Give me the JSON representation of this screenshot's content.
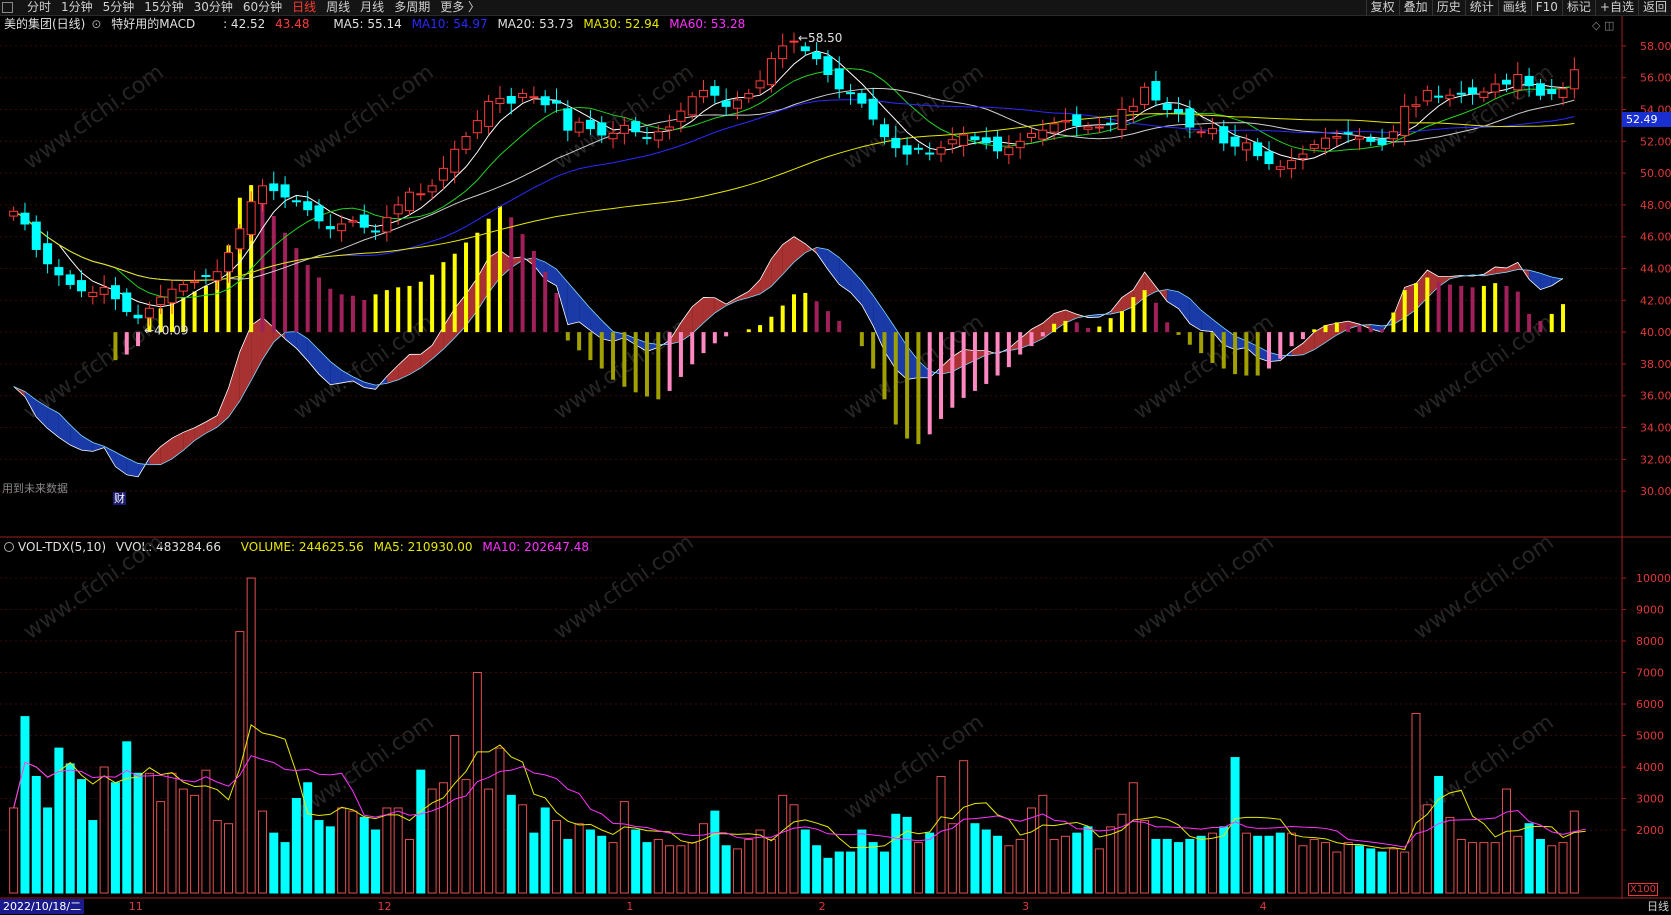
{
  "toolbar": {
    "periods": [
      "分时",
      "1分钟",
      "5分钟",
      "15分钟",
      "30分钟",
      "60分钟",
      "日线",
      "周线",
      "月线",
      "多周期",
      "更多 〉"
    ],
    "active_period": "日线",
    "right_buttons": [
      "复权",
      "叠加",
      "历史",
      "统计",
      "画线",
      "F10",
      "标记",
      "+自选",
      "返回"
    ]
  },
  "main_info": {
    "stock": "美的集团(日线)",
    "indicator": "特好用的MACD",
    "val1": ": 42.52",
    "val2": "43.48",
    "ma5": "MA5: 55.14",
    "ma10": "MA10: 54.97",
    "ma20": "MA20: 53.73",
    "ma30": "MA30: 52.94",
    "ma60": "MA60: 53.28"
  },
  "vol_info": {
    "name": "VOL-TDX(5,10)",
    "vvol": "VVOL: 483284.66",
    "volume": "VOLUME: 244625.56",
    "ma5": "MA5: 210930.00",
    "ma10": "MA10: 202647.48"
  },
  "price_axis": [
    "58.00",
    "56.00",
    "54.00",
    "52.00",
    "50.00",
    "48.00",
    "46.00",
    "44.00",
    "42.00",
    "40.00",
    "38.00",
    "36.00",
    "34.00",
    "32.00",
    "30.00"
  ],
  "vol_axis": [
    "10000",
    "9000",
    "8000",
    "7000",
    "6000",
    "5000",
    "4000",
    "3000",
    "2000"
  ],
  "high_label": "58.50",
  "low_label": "40.09",
  "current_price": "52.49",
  "future_note": "用到未来数据",
  "fin_badge": "财",
  "date_box": "2022/10/18/二",
  "month_labels": [
    "11",
    "12",
    "1",
    "2",
    "3",
    "4"
  ],
  "bottom_right": "日线",
  "x100": "X100",
  "watermark": "www.cfchi.com",
  "colors": {
    "up": "#ff3b3b",
    "down": "#00ffff",
    "ma5": "#ffffff",
    "ma10": "#2a2aff",
    "ma20": "#ffffff",
    "ma30": "#e8e800",
    "ma60": "#ff33ff",
    "macd_pos": "#ffff00",
    "macd_neg": "#a0a000"
  },
  "chart_data": {
    "type": "candlestick",
    "price_range": [
      28.5,
      59.0
    ],
    "closes": [
      47.6,
      46.8,
      45.2,
      44.3,
      43.6,
      43.0,
      42.6,
      42.5,
      42.8,
      42.1,
      41.3,
      40.9,
      41.5,
      42.2,
      42.7,
      43.0,
      43.2,
      43.5,
      43.8,
      45.0,
      46.5,
      48.2,
      49.2,
      48.9,
      48.5,
      48.2,
      47.7,
      47.0,
      46.5,
      46.8,
      47.0,
      46.6,
      46.3,
      47.2,
      48.0,
      48.8,
      48.7,
      49.2,
      50.3,
      51.5,
      52.3,
      53.3,
      54.5,
      54.7,
      54.4,
      55.0,
      54.8,
      54.3,
      54.4,
      52.7,
      53.2,
      52.8,
      52.4,
      52.5,
      53.0,
      52.6,
      52.2,
      52.6,
      52.9,
      53.9,
      54.8,
      55.2,
      54.9,
      54.2,
      54.6,
      55.0,
      55.8,
      57.2,
      58.0,
      58.3,
      57.7,
      57.2,
      56.2,
      55.3,
      55.0,
      54.4,
      53.4,
      52.3,
      51.6,
      51.2,
      51.5,
      51.2,
      51.6,
      52.1,
      52.4,
      52.1,
      51.9,
      51.4,
      51.6,
      52.0,
      52.5,
      52.7,
      53.1,
      53.3,
      53.0,
      52.9,
      52.9,
      53.1,
      54.0,
      54.2,
      55.4,
      54.6,
      54.0,
      53.8,
      52.9,
      52.6,
      52.8,
      51.9,
      51.7,
      51.9,
      51.1,
      50.6,
      50.4,
      50.8,
      51.2,
      51.8,
      52.2,
      52.3,
      52.5,
      52.3,
      52.0,
      51.8,
      52.6,
      54.2,
      54.3,
      55.2,
      54.8,
      54.9,
      55.0,
      55.0,
      55.1,
      55.6,
      55.6,
      56.2,
      55.5,
      54.9,
      55.0,
      55.3,
      56.5
    ],
    "macd_hist": [
      0,
      0,
      0,
      0,
      0,
      0,
      0,
      0,
      0,
      -2,
      -1.6,
      -1,
      1.2,
      1.7,
      2.1,
      2.5,
      2.9,
      3.3,
      3.8,
      6.2,
      9.6,
      10.5,
      9.6,
      8.3,
      7.1,
      6.0,
      4.8,
      3.9,
      3.1,
      2.7,
      2.6,
      2.3,
      2.7,
      3.0,
      3.2,
      3.3,
      3.6,
      4.1,
      5.0,
      5.6,
      6.4,
      7.1,
      8.1,
      9.0,
      8.2,
      7.0,
      5.8,
      4.3,
      2.8,
      -0.6,
      -1.3,
      -2.0,
      -2.6,
      -3.4,
      -3.9,
      -4.3,
      -4.6,
      -4.8,
      -4.2,
      -3.2,
      -2.3,
      -1.5,
      -0.8,
      -0.3,
      0,
      0.2,
      0.5,
      1.1,
      1.9,
      2.7,
      2.8,
      2.2,
      1.5,
      0.8,
      0,
      -1.0,
      -2.6,
      -4.8,
      -6.6,
      -7.6,
      -8.0,
      -7.3,
      -6.2,
      -5.4,
      -4.7,
      -4.2,
      -3.7,
      -3.1,
      -2.5,
      -1.6,
      -1.0,
      -0.3,
      0.6,
      0.8,
      0.7,
      0.3,
      0.4,
      1.0,
      1.5,
      2.5,
      3.0,
      2.1,
      0.7,
      -0.2,
      -0.9,
      -1.5,
      -2.2,
      -2.6,
      -3.0,
      -3.1,
      -3.1,
      -2.6,
      -1.9,
      -1.0,
      -0.5,
      0.2,
      0.5,
      0.7,
      0.6,
      0.5,
      0.3,
      0.2,
      1.4,
      3.0,
      3.5,
      3.9,
      3.6,
      3.4,
      3.3,
      3.2,
      3.3,
      3.5,
      3.3,
      2.9,
      1.3,
      0.8,
      1.3,
      2.0
    ],
    "volumes": [
      2700,
      5600,
      3700,
      2700,
      4600,
      4100,
      3600,
      2300,
      4000,
      3500,
      4800,
      3800,
      3800,
      2900,
      3800,
      3300,
      3100,
      3900,
      2300,
      2200,
      8300,
      10000,
      2600,
      1900,
      1600,
      3000,
      3500,
      2300,
      2100,
      2700,
      2600,
      2400,
      2000,
      2700,
      2700,
      1700,
      3900,
      3300,
      3500,
      5000,
      3600,
      7000,
      3300,
      4600,
      3100,
      2800,
      1900,
      2700,
      2300,
      1700,
      2200,
      2000,
      1800,
      1600,
      2900,
      2000,
      1600,
      1700,
      1500,
      1500,
      1600,
      2200,
      2600,
      1500,
      1400,
      1700,
      2000,
      1700,
      3100,
      2800,
      2000,
      1500,
      1100,
      1300,
      1300,
      2000,
      1600,
      1300,
      2500,
      2400,
      1600,
      1900,
      3700,
      2200,
      4200,
      2200,
      2000,
      1800,
      1500,
      1700,
      2700,
      3100,
      1700,
      1800,
      1900,
      2100,
      1400,
      2100,
      2500,
      3500,
      2300,
      1700,
      1700,
      1600,
      1700,
      1800,
      1900,
      2100,
      4300,
      1900,
      1800,
      1800,
      1900,
      1900,
      1500,
      1700,
      1600,
      1300,
      1600,
      1500,
      1400,
      1300,
      1400,
      1300,
      5700,
      2800,
      3700,
      2400,
      1700,
      1600,
      1600,
      1600,
      3300,
      1800,
      2200,
      1700,
      1500,
      1600,
      2600,
      2400
    ]
  }
}
